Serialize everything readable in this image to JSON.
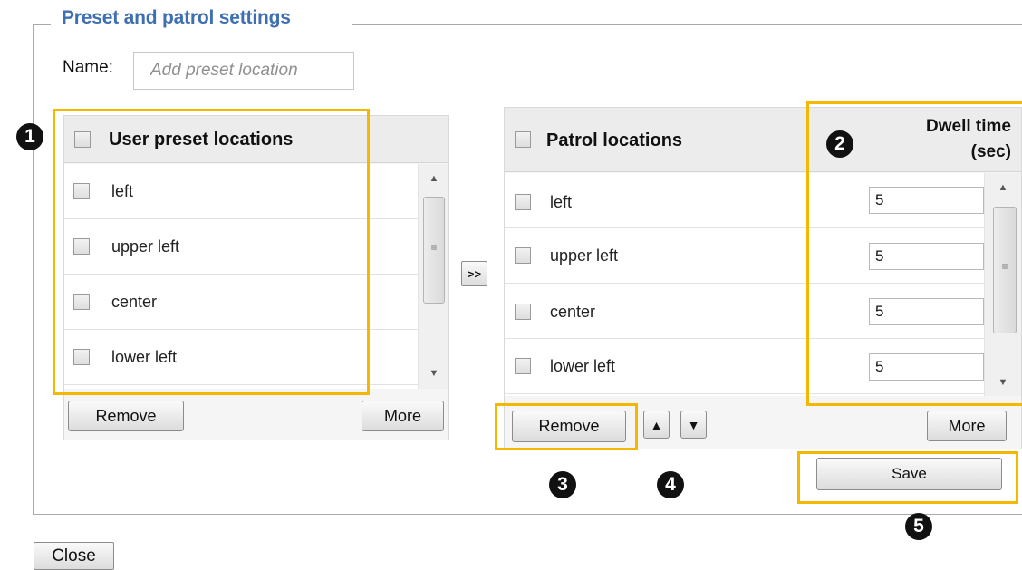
{
  "section": {
    "title": "Preset and patrol settings"
  },
  "name_field": {
    "label": "Name:",
    "placeholder": "Add preset location"
  },
  "preset_list": {
    "header": "User preset locations",
    "items": [
      "left",
      "upper left",
      "center",
      "lower left"
    ],
    "remove_label": "Remove",
    "more_label": "More"
  },
  "transfer_button": {
    "label": ">>"
  },
  "patrol_list": {
    "header": "Patrol locations",
    "dwell_header_line1": "Dwell time",
    "dwell_header_line2": "(sec)",
    "items": [
      {
        "name": "left",
        "dwell": "5"
      },
      {
        "name": "upper left",
        "dwell": "5"
      },
      {
        "name": "center",
        "dwell": "5"
      },
      {
        "name": "lower left",
        "dwell": "5"
      }
    ],
    "remove_label": "Remove",
    "move_up_label": "▲",
    "move_down_label": "▼",
    "more_label": "More"
  },
  "save_label": "Save",
  "close_label": "Close",
  "callouts": [
    "1",
    "2",
    "3",
    "4",
    "5"
  ],
  "colors": {
    "title": "#3e6fb3",
    "highlight": "#f5b800",
    "badge": "#111111"
  }
}
